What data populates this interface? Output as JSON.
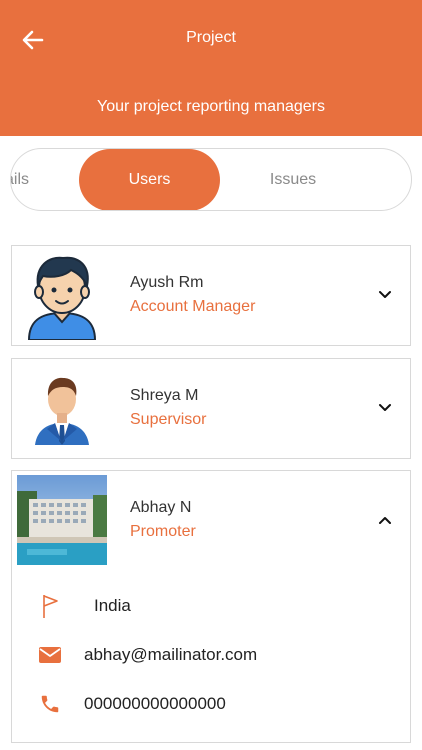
{
  "header": {
    "title": "Project",
    "subtitle": "Your project reporting managers",
    "color": "#E8703E"
  },
  "tabs": {
    "details_label": "ails",
    "users_label": "Users",
    "issues_label": "Issues",
    "active": "Users"
  },
  "users": [
    {
      "name": "Ayush Rm",
      "role": "Account Manager",
      "expanded": false,
      "avatar": "cartoon-boy-avatar"
    },
    {
      "name": "Shreya M",
      "role": "Supervisor",
      "expanded": false,
      "avatar": "businessman-avatar"
    },
    {
      "name": "Abhay N",
      "role": "Promoter",
      "expanded": true,
      "avatar": "hotel-photo",
      "details": {
        "country": "India",
        "email": "abhay@mailinator.com",
        "phone": "000000000000000"
      }
    }
  ],
  "icons": {
    "back": "arrow-left-icon",
    "chevron_down": "chevron-down-icon",
    "chevron_up": "chevron-up-icon",
    "flag": "flag-icon",
    "mail": "mail-icon",
    "phone": "phone-icon"
  },
  "accent_color": "#E8703E"
}
